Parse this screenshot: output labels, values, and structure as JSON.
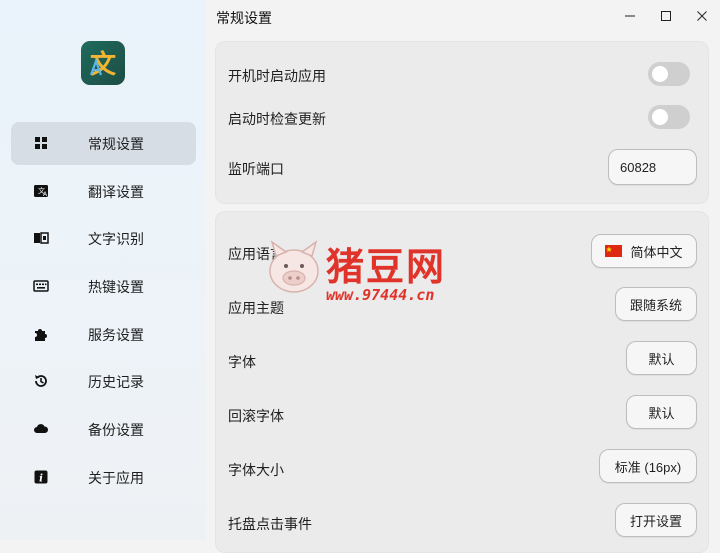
{
  "window": {
    "title": "常规设置"
  },
  "sidebar": {
    "items": [
      {
        "label": "常规设置",
        "icon": "grid-icon"
      },
      {
        "label": "翻译设置",
        "icon": "translate-icon"
      },
      {
        "label": "文字识别",
        "icon": "ocr-icon"
      },
      {
        "label": "热键设置",
        "icon": "keyboard-icon"
      },
      {
        "label": "服务设置",
        "icon": "puzzle-icon"
      },
      {
        "label": "历史记录",
        "icon": "history-icon"
      },
      {
        "label": "备份设置",
        "icon": "cloud-icon"
      },
      {
        "label": "关于应用",
        "icon": "info-icon"
      }
    ],
    "active_index": 0
  },
  "general": {
    "autostart_label": "开机时启动应用",
    "autostart_on": false,
    "check_update_label": "启动时检查更新",
    "check_update_on": false,
    "port_label": "监听端口",
    "port_value": "60828"
  },
  "appearance": {
    "language_label": "应用语言",
    "language_value": "简体中文",
    "theme_label": "应用主题",
    "theme_value": "跟随系统",
    "font_label": "字体",
    "font_value": "默认",
    "fallback_font_label": "回滚字体",
    "fallback_font_value": "默认",
    "font_size_label": "字体大小",
    "font_size_value": "标准 (16px)",
    "tray_click_label": "托盘点击事件",
    "tray_click_value": "打开设置"
  },
  "watermark": {
    "brand": "猪豆网",
    "url": "www.97444.cn"
  },
  "colors": {
    "active_bg": "#d6dde4",
    "flag_red": "#de2910",
    "watermark_red": "#e0342b"
  }
}
